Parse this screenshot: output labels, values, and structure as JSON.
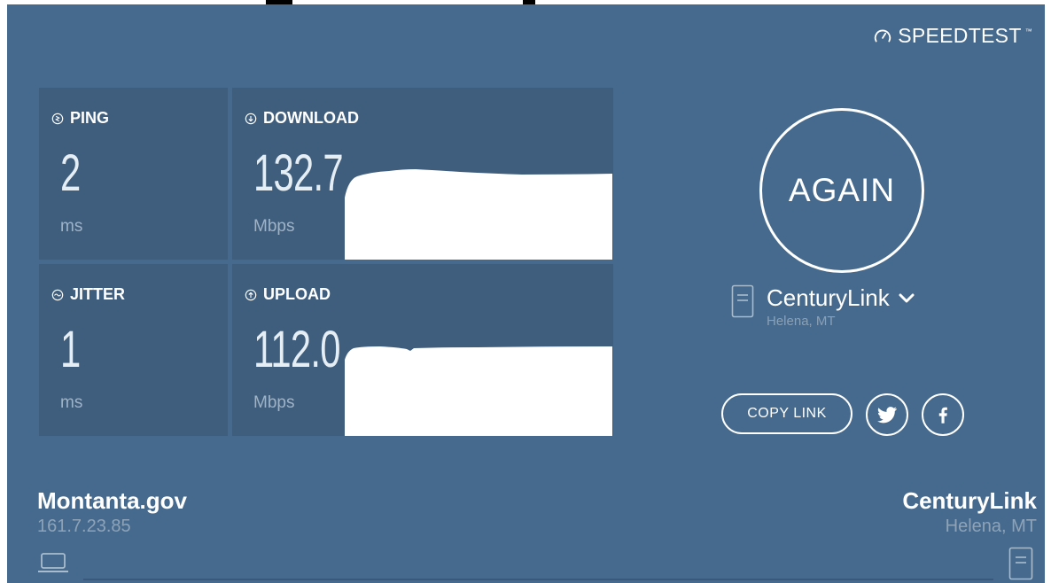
{
  "brand": {
    "name": "SPEEDTEST",
    "icon": "gauge-icon"
  },
  "metrics": {
    "ping": {
      "label": "PING",
      "value": "2",
      "unit": "ms",
      "icon": "ping-icon"
    },
    "jitter": {
      "label": "JITTER",
      "value": "1",
      "unit": "ms",
      "icon": "jitter-icon"
    },
    "download": {
      "label": "DOWNLOAD",
      "value": "132.7",
      "unit": "Mbps",
      "icon": "download-arrow-icon"
    },
    "upload": {
      "label": "UPLOAD",
      "value": "112.0",
      "unit": "Mbps",
      "icon": "upload-arrow-icon"
    }
  },
  "again_button": {
    "label": "AGAIN"
  },
  "server": {
    "name": "CenturyLink",
    "location": "Helena, MT",
    "icon": "server-icon"
  },
  "share": {
    "copy_link": "COPY LINK",
    "twitter_icon": "twitter-icon",
    "facebook_icon": "facebook-icon"
  },
  "client": {
    "isp": "Montanta.gov",
    "ip": "161.7.23.85",
    "icon": "laptop-icon"
  },
  "host": {
    "name": "CenturyLink",
    "location": "Helena, MT",
    "icon": "server-icon"
  },
  "colors": {
    "background": "#466a8d",
    "tile": "#3f5e7d",
    "text": "#ffffff",
    "muted": "#8ea3b8"
  }
}
